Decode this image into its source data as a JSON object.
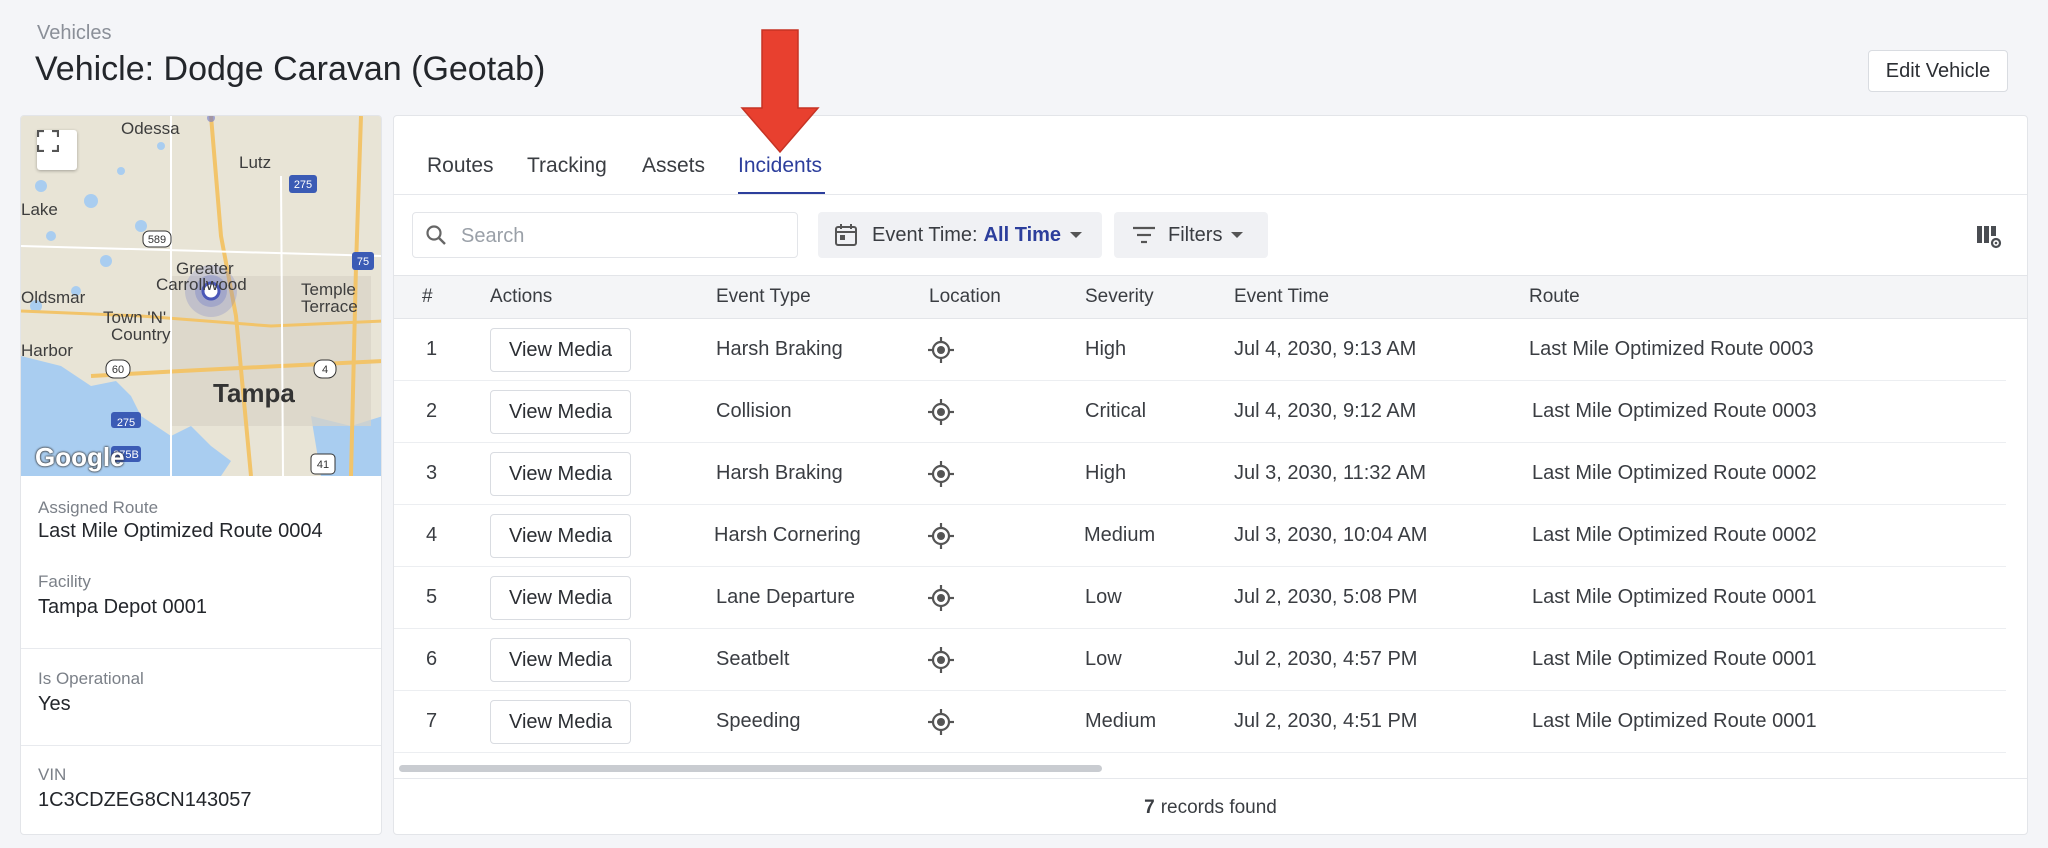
{
  "header": {
    "breadcrumb": "Vehicles",
    "title": "Vehicle: Dodge Caravan (Geotab)",
    "edit_button": "Edit Vehicle"
  },
  "map": {
    "labels": [
      "Odessa",
      "Lutz",
      "Lake",
      "Greater",
      "Carrollwood",
      "Temple",
      "Terrace",
      "Oldsmar",
      "Town 'N'",
      "Country",
      "Harbor",
      "Tampa"
    ],
    "shields": [
      "275",
      "589",
      "75",
      "60",
      "275",
      "4",
      "275B",
      "41"
    ],
    "logo": "Google"
  },
  "vehicle_info": {
    "assigned_route_label": "Assigned Route",
    "assigned_route_value": "Last Mile Optimized Route 0004",
    "facility_label": "Facility",
    "facility_value": "Tampa Depot 0001",
    "operational_label": "Is Operational",
    "operational_value": "Yes",
    "vin_label": "VIN",
    "vin_value": "1C3CDZEG8CN143057"
  },
  "tabs": [
    {
      "label": "Routes",
      "active": false
    },
    {
      "label": "Tracking",
      "active": false
    },
    {
      "label": "Assets",
      "active": false
    },
    {
      "label": "Incidents",
      "active": true
    }
  ],
  "toolbar": {
    "search_placeholder": "Search",
    "event_time_label": "Event Time:",
    "event_time_value": "All Time",
    "filters_label": "Filters"
  },
  "table": {
    "columns": [
      "#",
      "Actions",
      "Event Type",
      "Location",
      "Severity",
      "Event Time",
      "Route"
    ],
    "action_label": "View Media",
    "rows": [
      {
        "num": "1",
        "event_type": "Harsh Braking",
        "severity": "High",
        "event_time": "Jul 4, 2030, 9:13 AM",
        "route": "Last Mile Optimized Route 0003"
      },
      {
        "num": "2",
        "event_type": "Collision",
        "severity": "Critical",
        "event_time": "Jul 4, 2030, 9:12 AM",
        "route": "Last Mile Optimized Route 0003"
      },
      {
        "num": "3",
        "event_type": "Harsh Braking",
        "severity": "High",
        "event_time": "Jul 3, 2030, 11:32 AM",
        "route": "Last Mile Optimized Route 0002"
      },
      {
        "num": "4",
        "event_type": "Harsh Cornering",
        "severity": "Medium",
        "event_time": "Jul 3, 2030, 10:04 AM",
        "route": "Last Mile Optimized Route 0002"
      },
      {
        "num": "5",
        "event_type": "Lane Departure",
        "severity": "Low",
        "event_time": "Jul 2, 2030, 5:08 PM",
        "route": "Last Mile Optimized Route 0001"
      },
      {
        "num": "6",
        "event_type": "Seatbelt",
        "severity": "Low",
        "event_time": "Jul 2, 2030, 4:57 PM",
        "route": "Last Mile Optimized Route 0001"
      },
      {
        "num": "7",
        "event_type": "Speeding",
        "severity": "Medium",
        "event_time": "Jul 2, 2030, 4:51 PM",
        "route": "Last Mile Optimized Route 0001"
      }
    ]
  },
  "footer": {
    "count": "7",
    "text": "records found"
  },
  "colors": {
    "accent": "#2c3e9c",
    "arrow": "#e8402f"
  }
}
